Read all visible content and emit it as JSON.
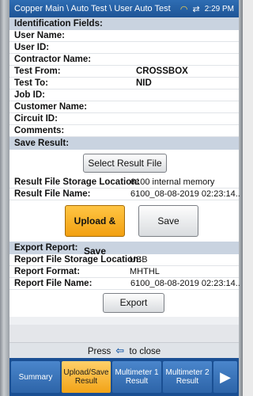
{
  "status": {
    "path": "Copper Main \\ Auto Test \\ User Auto Test",
    "time": "2:29 PM"
  },
  "identification": {
    "header": "Identification Fields:",
    "fields": [
      {
        "label": "User Name:",
        "value": ""
      },
      {
        "label": "User ID:",
        "value": ""
      },
      {
        "label": "Contractor Name:",
        "value": ""
      },
      {
        "label": "Test From:",
        "value": "CROSSBOX"
      },
      {
        "label": "Test To:",
        "value": "NID"
      },
      {
        "label": "Job ID:",
        "value": ""
      },
      {
        "label": "Customer Name:",
        "value": ""
      },
      {
        "label": "Circuit ID:",
        "value": ""
      },
      {
        "label": "Comments:",
        "value": ""
      }
    ]
  },
  "save_result": {
    "header": "Save Result:",
    "select_button": "Select Result File",
    "storage_label": "Result File Storage Location:",
    "storage_value": "6100 internal memory",
    "file_label": "Result File Name:",
    "file_value": "6100_08-08-2019 02:23:14..",
    "upload_save_button": "Upload & Save",
    "save_button": "Save"
  },
  "export_report": {
    "header": "Export Report:",
    "storage_label": "Report File Storage Location:",
    "storage_value": "USB",
    "format_label": "Report Format:",
    "format_value": "MHTHL",
    "file_label": "Report File Name:",
    "file_value": "6100_08-08-2019 02:23:14..",
    "export_button": "Export"
  },
  "footer": {
    "press_prefix": "Press",
    "press_suffix": "to close"
  },
  "tabs": [
    {
      "label": "Summary",
      "active": false
    },
    {
      "label": "Upload/Save Result",
      "active": true
    },
    {
      "label": "Multimeter 1 Result",
      "active": false
    },
    {
      "label": "Multimeter 2 Result",
      "active": false
    }
  ],
  "colors": {
    "statusbar": "#1e5496",
    "section_header": "#c9d3e0",
    "active_tab": "#f2a316",
    "tab": "#2d64a8"
  },
  "icons": [
    "wifi-icon",
    "sync-icon",
    "back-arrow-icon",
    "next-arrow-icon"
  ]
}
